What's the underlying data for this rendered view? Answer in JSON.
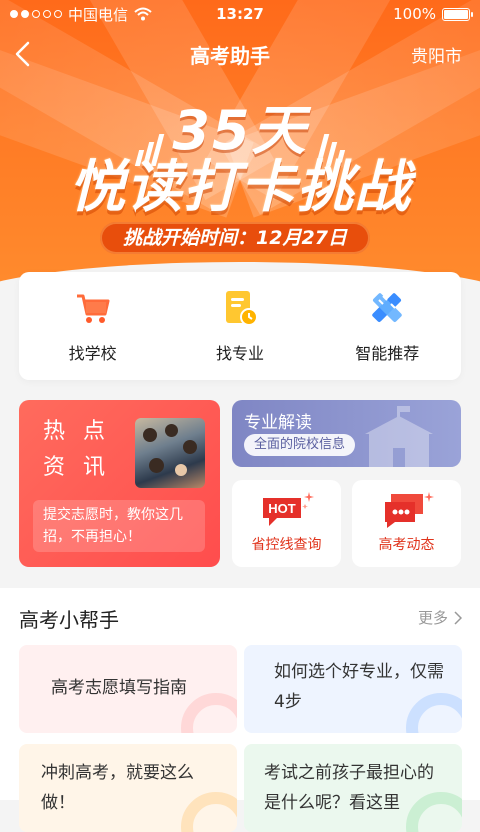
{
  "status_bar": {
    "carrier": "中国电信",
    "time": "13:27",
    "battery": "100%"
  },
  "navbar": {
    "title": "高考助手",
    "city": "贵阳市"
  },
  "banner": {
    "days": "35天",
    "title": "悦读打卡挑战",
    "start_time": "挑战开始时间：12月27日"
  },
  "quick_actions": [
    {
      "label": "找学校",
      "icon": "shopping-cart-icon"
    },
    {
      "label": "找专业",
      "icon": "document-clock-icon"
    },
    {
      "label": "智能推荐",
      "icon": "ruler-pencil-icon"
    }
  ],
  "hot_news": {
    "title": "热点资讯",
    "desc": "提交志愿时，教你这几招，不再担心！"
  },
  "major": {
    "title": "专业解读",
    "sub": "全面的院校信息"
  },
  "mini_cards": [
    {
      "label": "省控线查询",
      "badge": "HOT"
    },
    {
      "label": "高考动态"
    }
  ],
  "helper": {
    "title": "高考小帮手",
    "more": "更多",
    "tips": [
      {
        "text": "高考志愿填写指南"
      },
      {
        "text": "如何选个好专业，仅需4步"
      },
      {
        "text": "冲刺高考，就要这么做！"
      },
      {
        "text": "考试之前孩子最担心的是什么呢？看这里"
      }
    ]
  },
  "colors": {
    "banner": "#ff7b25",
    "accent_red": "#ff4d4d",
    "major_purple": "#8a90cc"
  }
}
